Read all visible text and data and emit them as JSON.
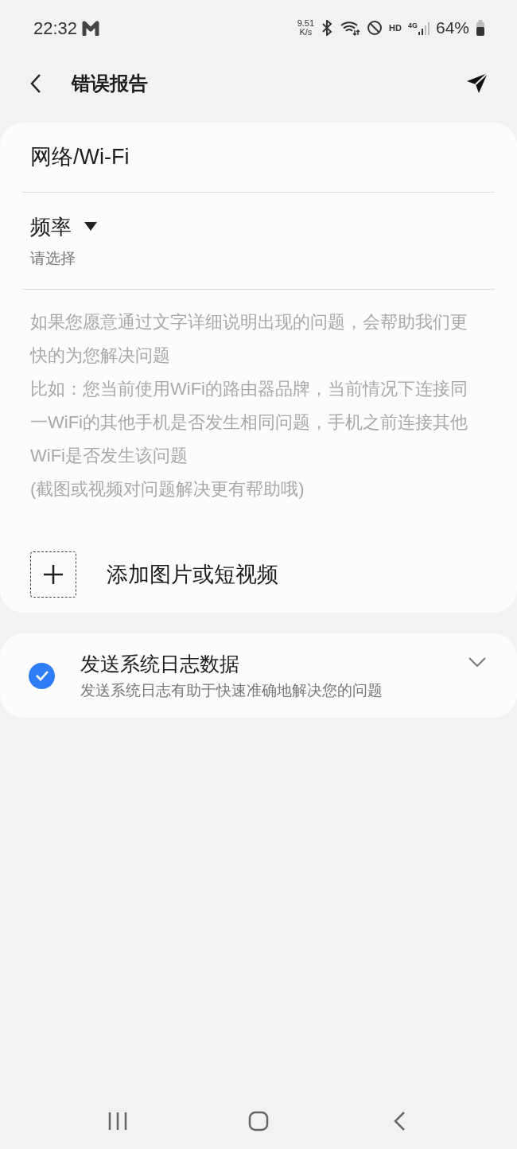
{
  "status_bar": {
    "time": "22:32",
    "speed_value": "9.51",
    "speed_unit": "K/s",
    "hd": "HD",
    "network": "4G",
    "battery": "64%"
  },
  "header": {
    "title": "错误报告"
  },
  "report": {
    "category": "网络/Wi-Fi",
    "frequency": {
      "label": "频率",
      "value": "请选择"
    },
    "description": {
      "placeholder": [
        "如果您愿意通过文字详细说明出现的问题，会帮助我们更快的为您解决问题",
        "比如：您当前使用WiFi的路由器品牌，当前情况下连接同一WiFi的其他手机是否发生相同问题，手机之前连接其他WiFi是否发生该问题",
        "(截图或视频对问题解决更有帮助哦)"
      ]
    },
    "attachment": {
      "label": "添加图片或短视频"
    }
  },
  "log_option": {
    "title": "发送系统日志数据",
    "subtitle": "发送系统日志有助于快速准确地解决您的问题",
    "checked": true,
    "expanded": false
  }
}
